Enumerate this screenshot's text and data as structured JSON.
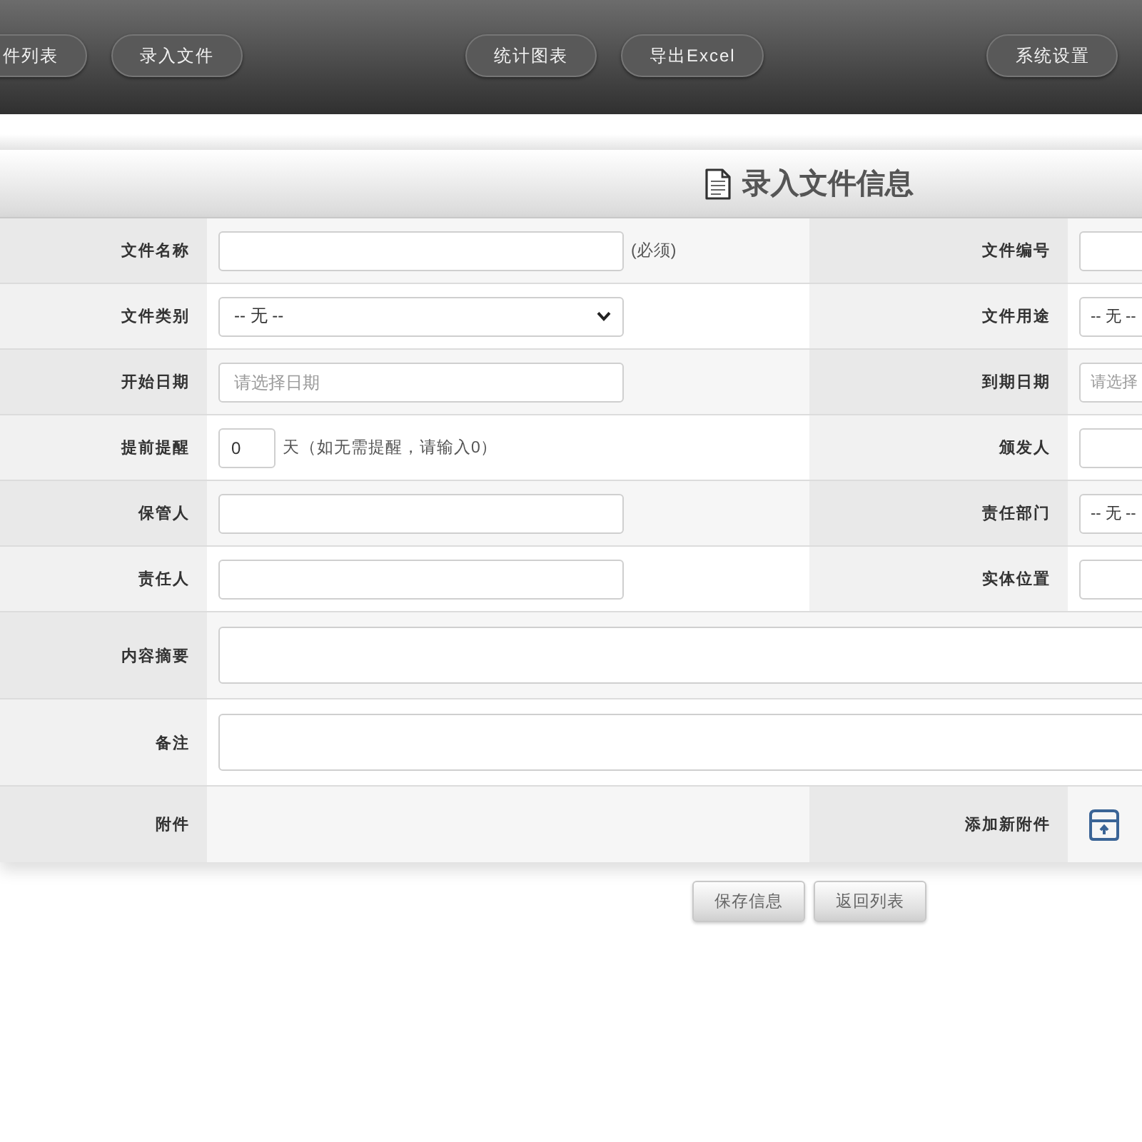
{
  "nav": {
    "groups": [
      {
        "buttons": [
          {
            "label": "件列表"
          },
          {
            "label": "录入文件"
          }
        ]
      },
      {
        "buttons": [
          {
            "label": "统计图表"
          },
          {
            "label": "导出Excel"
          }
        ]
      },
      {
        "buttons": [
          {
            "label": "系统设置"
          }
        ]
      }
    ]
  },
  "form": {
    "title": "录入文件信息",
    "rows": [
      {
        "kind": "pair",
        "cells": [
          {
            "label": "文件名称",
            "field": {
              "kind": "text",
              "note": "(必须)"
            }
          },
          {
            "label": "文件编号",
            "field": {
              "kind": "text"
            }
          }
        ]
      },
      {
        "kind": "pair",
        "cells": [
          {
            "label": "文件类别",
            "field": {
              "kind": "select",
              "value": "-- 无 --"
            }
          },
          {
            "label": "文件用途",
            "field": {
              "kind": "select",
              "value": "-- 无 --"
            }
          }
        ]
      },
      {
        "kind": "pair",
        "cells": [
          {
            "label": "开始日期",
            "field": {
              "kind": "text",
              "placeholder": "请选择日期"
            }
          },
          {
            "label": "到期日期",
            "field": {
              "kind": "text",
              "placeholder": "请选择"
            }
          }
        ]
      },
      {
        "kind": "pair",
        "cells": [
          {
            "label": "提前提醒",
            "field": {
              "kind": "short",
              "value": "0",
              "note": "天（如无需提醒，请输入0）"
            }
          },
          {
            "label": "颁发人",
            "field": {
              "kind": "text"
            }
          }
        ]
      },
      {
        "kind": "pair",
        "cells": [
          {
            "label": "保管人",
            "field": {
              "kind": "text"
            }
          },
          {
            "label": "责任部门",
            "field": {
              "kind": "select",
              "value": "-- 无 --"
            }
          }
        ]
      },
      {
        "kind": "pair",
        "cells": [
          {
            "label": "责任人",
            "field": {
              "kind": "text"
            }
          },
          {
            "label": "实体位置",
            "field": {
              "kind": "text"
            }
          }
        ]
      },
      {
        "kind": "wide",
        "cells": [
          {
            "label": "内容摘要",
            "field": {
              "kind": "textarea"
            }
          }
        ]
      },
      {
        "kind": "wide",
        "cells": [
          {
            "label": "备注",
            "field": {
              "kind": "textarea"
            }
          }
        ]
      },
      {
        "kind": "pair",
        "cells": [
          {
            "label": "附件"
          },
          {
            "label": "添加新附件",
            "field": {
              "kind": "upload"
            }
          }
        ]
      }
    ]
  },
  "actions": [
    {
      "label": "保存信息"
    },
    {
      "label": "返回列表"
    }
  ]
}
